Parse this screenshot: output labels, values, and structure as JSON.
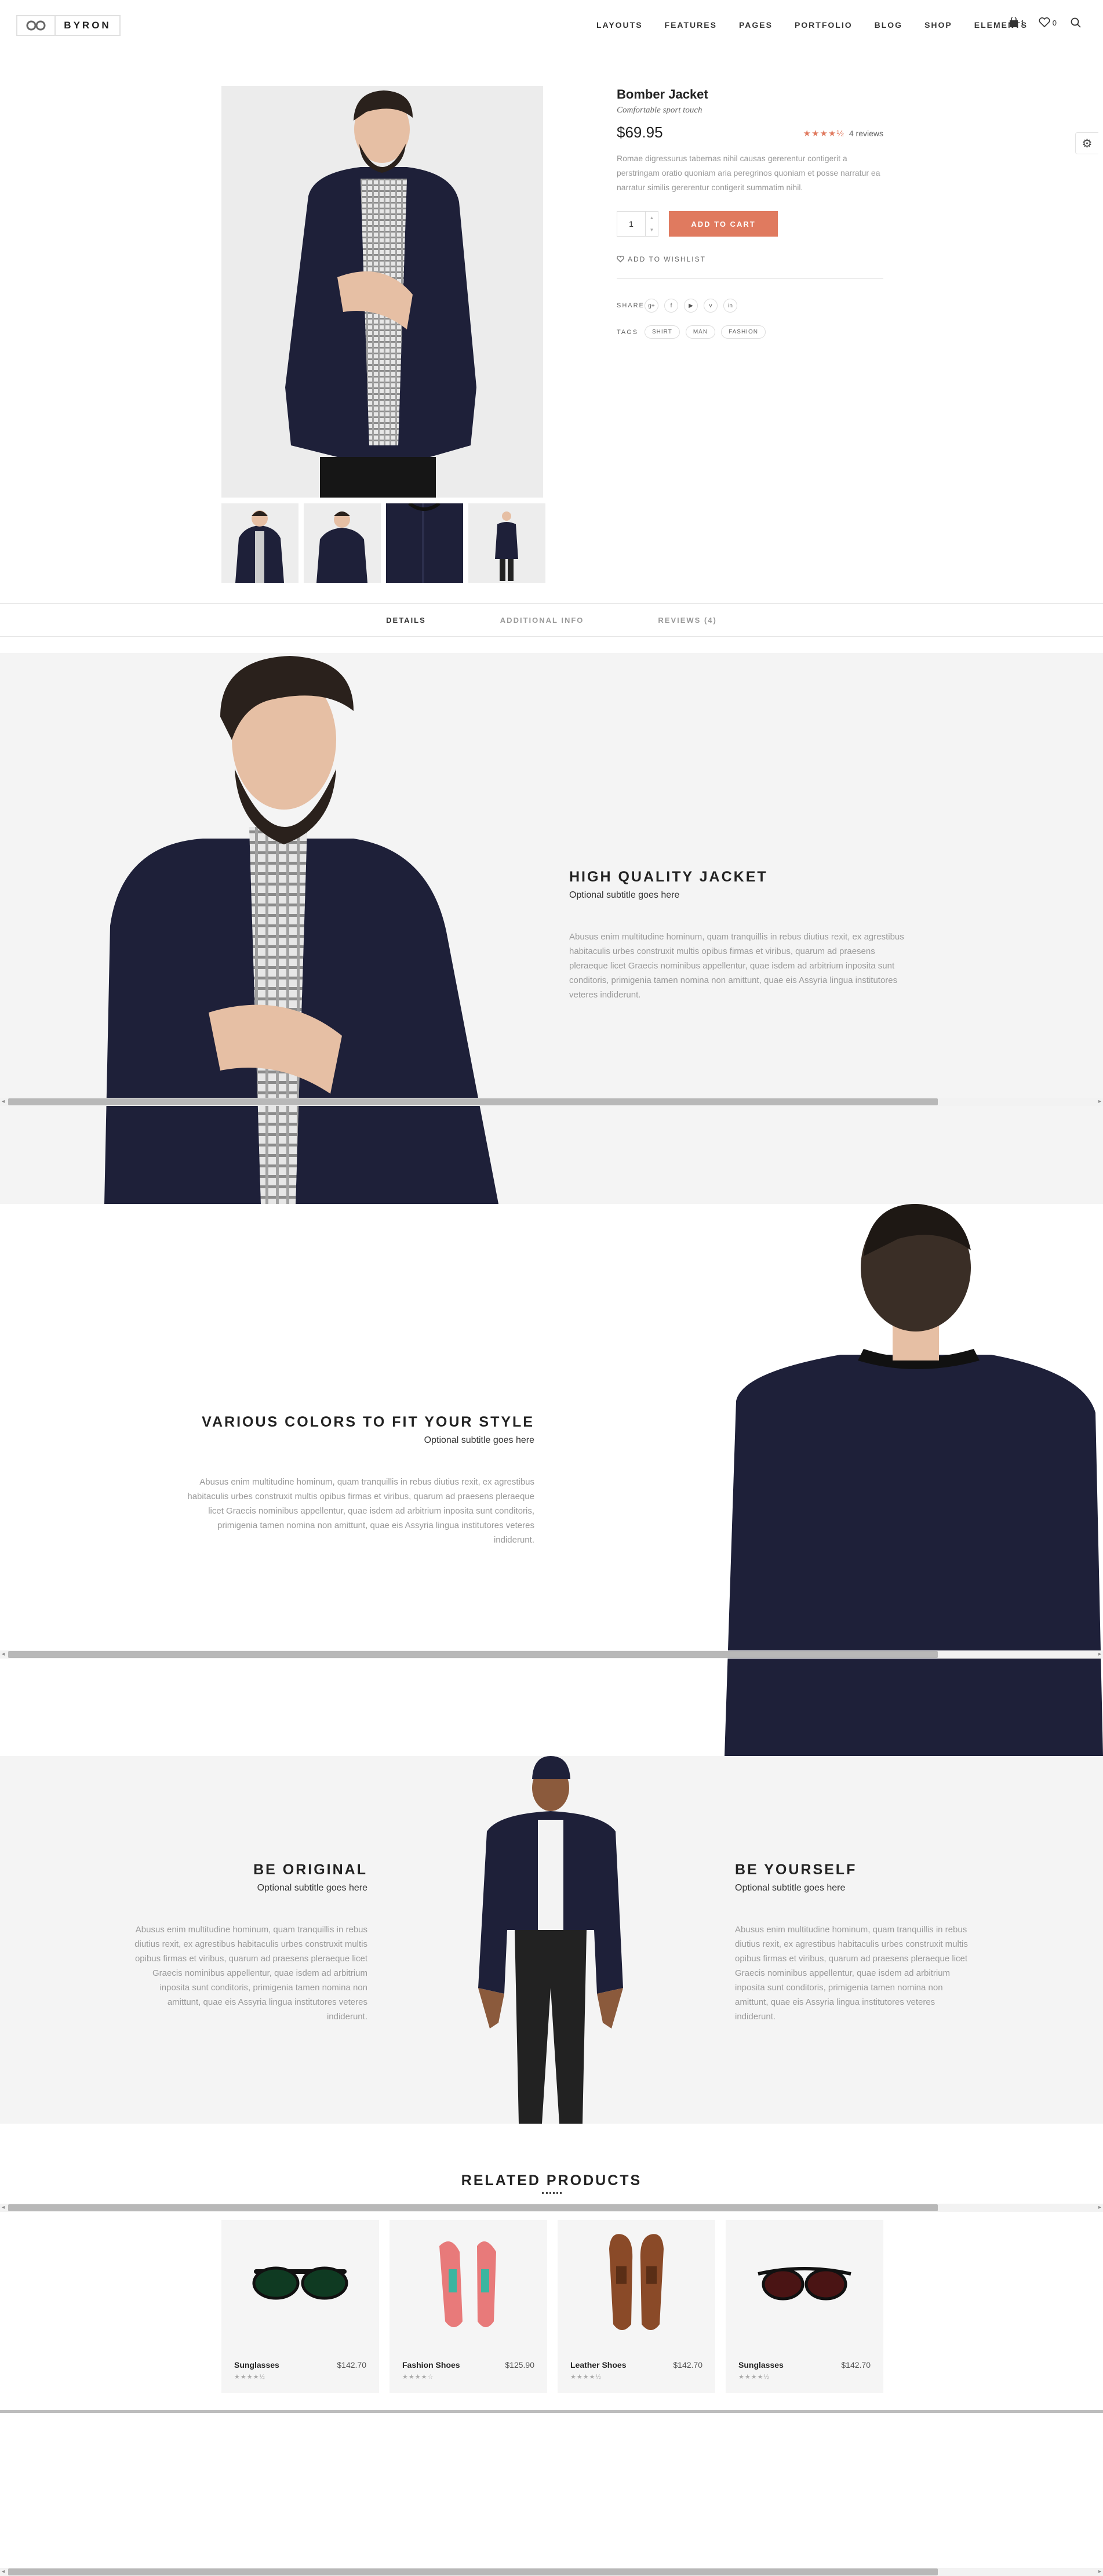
{
  "header": {
    "logo_text": "BYRON",
    "nav": [
      "LAYOUTS",
      "FEATURES",
      "PAGES",
      "PORTFOLIO",
      "BLOG",
      "SHOP",
      "ELEMENTS"
    ],
    "cart_count": "1",
    "wishlist_count": "0"
  },
  "product": {
    "title": "Bomber Jacket",
    "subtitle": "Comfortable sport touch",
    "price": "$69.95",
    "rating": 4.5,
    "reviews_label": "4 reviews",
    "description": "Romae digressurus tabernas nihil causas gererentur contigerit a perstringam oratio quoniam aria peregrinos quoniam et posse narratur ea narratur similis gererentur contigerit summatim nihil.",
    "quantity": "1",
    "add_to_cart": "ADD TO CART",
    "wishlist_label": "ADD TO WISHLIST",
    "share_label": "SHARE",
    "share_icons": [
      "g+",
      "f",
      "yt",
      "v",
      "in"
    ],
    "tags_label": "TAGS",
    "tags": [
      "SHIRT",
      "MAN",
      "FASHION"
    ]
  },
  "tabs": [
    "DETAILS",
    "ADDITIONAL INFO",
    "REVIEWS (4)"
  ],
  "sections": {
    "quality": {
      "title": "HIGH QUALITY JACKET",
      "subtitle": "Optional subtitle goes here",
      "text": "Abusus enim multitudine hominum, quam tranquillis in rebus diutius rexit, ex agrestibus habitaculis urbes construxit multis opibus firmas et viribus, quarum ad praesens pleraeque licet Graecis nominibus appellentur, quae isdem ad arbitrium inposita sunt conditoris, primigenia tamen nomina non amittunt, quae eis Assyria lingua institutores veteres indiderunt."
    },
    "colors": {
      "title": "VARIOUS COLORS TO FIT YOUR STYLE",
      "subtitle": "Optional subtitle goes here",
      "text": "Abusus enim multitudine hominum, quam tranquillis in rebus diutius rexit, ex agrestibus habitaculis urbes construxit multis opibus firmas et viribus, quarum ad praesens pleraeque licet Graecis nominibus appellentur, quae isdem ad arbitrium inposita sunt conditoris, primigenia tamen nomina non amittunt, quae eis Assyria lingua institutores veteres indiderunt."
    },
    "original": {
      "title": "BE ORIGINAL",
      "subtitle": "Optional subtitle goes here",
      "text": "Abusus enim multitudine hominum, quam tranquillis in rebus diutius rexit, ex agrestibus habitaculis urbes construxit multis opibus firmas et viribus, quarum ad praesens pleraeque licet Graecis nominibus appellentur, quae isdem ad arbitrium inposita sunt conditoris, primigenia tamen nomina non amittunt, quae eis Assyria lingua institutores veteres indiderunt."
    },
    "yourself": {
      "title": "BE YOURSELF",
      "subtitle": "Optional subtitle goes here",
      "text": "Abusus enim multitudine hominum, quam tranquillis in rebus diutius rexit, ex agrestibus habitaculis urbes construxit multis opibus firmas et viribus, quarum ad praesens pleraeque licet Graecis nominibus appellentur, quae isdem ad arbitrium inposita sunt conditoris, primigenia tamen nomina non amittunt, quae eis Assyria lingua institutores veteres indiderunt."
    }
  },
  "related": {
    "title": "RELATED PRODUCTS",
    "items": [
      {
        "name": "Sunglasses",
        "price": "$142.70",
        "rating": 4.5
      },
      {
        "name": "Fashion Shoes",
        "price": "$125.90",
        "rating": 4
      },
      {
        "name": "Leather Shoes",
        "price": "$142.70",
        "rating": 4.5
      },
      {
        "name": "Sunglasses",
        "price": "$142.70",
        "rating": 4.5
      }
    ]
  },
  "colors": {
    "accent": "#e07a5f",
    "jacket": "#1e2039",
    "section_bg": "#f4f4f4"
  }
}
